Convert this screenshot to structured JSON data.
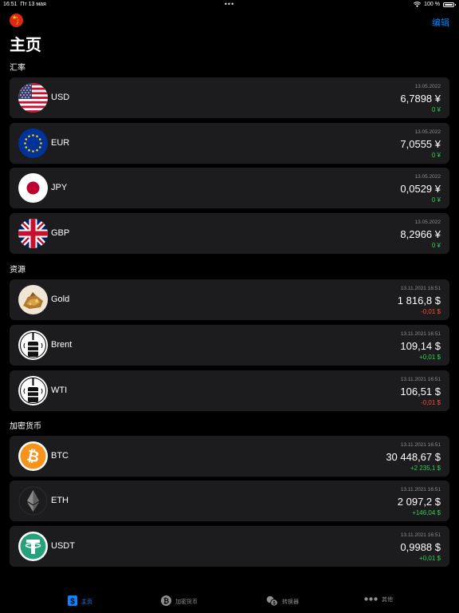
{
  "status_bar": {
    "time": "16:51",
    "date": "Пт 13 мая",
    "dots": "•••",
    "battery": "100 %"
  },
  "header": {
    "edit": "编辑",
    "title": "主页"
  },
  "colors": {
    "accent": "#0a84ff",
    "positive": "#30d158",
    "negative": "#ff453a",
    "card": "#1c1c1e"
  },
  "sections": {
    "rates": {
      "title": "汇率",
      "items": [
        {
          "name": "USD",
          "date": "13.05.2022",
          "value": "6,7898 ¥",
          "change": "0 ¥",
          "icon": "us-flag-icon"
        },
        {
          "name": "EUR",
          "date": "13.05.2022",
          "value": "7,0555 ¥",
          "change": "0 ¥",
          "icon": "eu-flag-icon"
        },
        {
          "name": "JPY",
          "date": "13.05.2022",
          "value": "0,0529 ¥",
          "change": "0 ¥",
          "icon": "jp-flag-icon"
        },
        {
          "name": "GBP",
          "date": "13.05.2022",
          "value": "8,2966 ¥",
          "change": "0 ¥",
          "icon": "gb-flag-icon"
        }
      ]
    },
    "resources": {
      "title": "资源",
      "items": [
        {
          "name": "Gold",
          "date": "13.11.2021 16:51",
          "value": "1 816,8 $",
          "change": "-0,01 $",
          "icon": "gold-icon"
        },
        {
          "name": "Brent",
          "date": "13.11.2021 16:51",
          "value": "109,14 $",
          "change": "+0,01 $",
          "icon": "oil-barrel-icon"
        },
        {
          "name": "WTI",
          "date": "13.11.2021 16:51",
          "value": "106,51 $",
          "change": "-0,01 $",
          "icon": "oil-barrel-icon"
        }
      ]
    },
    "crypto": {
      "title": "加密货币",
      "items": [
        {
          "name": "BTC",
          "date": "13.11.2021 16:51",
          "value": "30 448,67 $",
          "change": "+2 235,1 $",
          "icon": "bitcoin-icon"
        },
        {
          "name": "ETH",
          "date": "13.11.2021 16:51",
          "value": "2 097,2 $",
          "change": "+146,04 $",
          "icon": "ethereum-icon"
        },
        {
          "name": "USDT",
          "date": "13.11.2021 16:51",
          "value": "0,9988 $",
          "change": "+0,01 $",
          "icon": "tether-icon"
        }
      ]
    }
  },
  "tabs": [
    {
      "label": "主页",
      "icon": "dollar-icon",
      "active": true
    },
    {
      "label": "加密货币",
      "icon": "bitcoin-coin-icon",
      "active": false
    },
    {
      "label": "转换器",
      "icon": "converter-icon",
      "active": false
    },
    {
      "label": "其他",
      "icon": "more-icon",
      "active": false
    }
  ]
}
